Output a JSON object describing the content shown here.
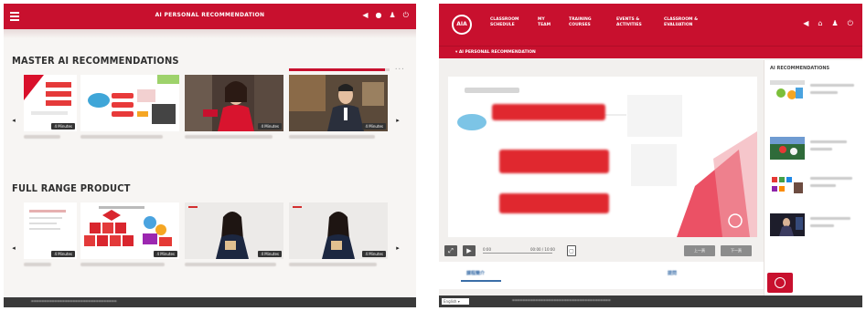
{
  "left_panel": {
    "header": {
      "title": "AI PERSONAL RECOMMENDATION",
      "menu_icon": "hamburger-icon",
      "icons": [
        "megaphone-icon",
        "home-icon",
        "user-icon",
        "power-icon"
      ]
    },
    "section_master": {
      "title": "MASTER AI RECOMMENDATIONS",
      "progress": 0.95,
      "cards": [
        {
          "badge": "4 Minutes",
          "thumb": "presentation-slide"
        },
        {
          "badge": "",
          "thumb": "diagram"
        },
        {
          "badge": "4 Minutes",
          "thumb": "presenter-woman"
        },
        {
          "badge": "4 Minutes",
          "thumb": "presenter-man"
        }
      ]
    },
    "section_full": {
      "title": "FULL RANGE PRODUCT",
      "cards": [
        {
          "badge": "4 Minutes",
          "thumb": "document"
        },
        {
          "badge": "4 Minutes",
          "thumb": "house-blocks"
        },
        {
          "badge": "4 Minutes",
          "thumb": "presenter-woman"
        },
        {
          "badge": "4 Minutes",
          "thumb": "presenter-woman"
        }
      ]
    },
    "nav": {
      "prev": "◂",
      "next": "▸"
    }
  },
  "right_panel": {
    "header": {
      "logo": "AIA",
      "nav_items": [
        "CLASSROOM SCHEDULE",
        "MY TEAM",
        "TRAINING COURSES",
        "EVENTS & ACTIVITIES",
        "CLASSROOM & EVALUATION"
      ],
      "icons": [
        "megaphone-icon",
        "home-icon",
        "user-icon",
        "power-icon"
      ]
    },
    "breadcrumb": "AI PERSONAL RECOMMENDATION",
    "player": {
      "time_current": "0:00",
      "time_total": "00:00 / 10:00",
      "prev_label": "上一頁",
      "next_label": "下一頁"
    },
    "tabs": [
      "課程簡介",
      "提問"
    ],
    "sidebar": {
      "title": "AI RECOMMENDATIONS",
      "item_count": 4
    },
    "footer": {
      "language": "English"
    }
  },
  "colors": {
    "brand_red": "#c8102e",
    "footer_dark": "#3a3a3a",
    "link_blue": "#3a6ea8"
  }
}
